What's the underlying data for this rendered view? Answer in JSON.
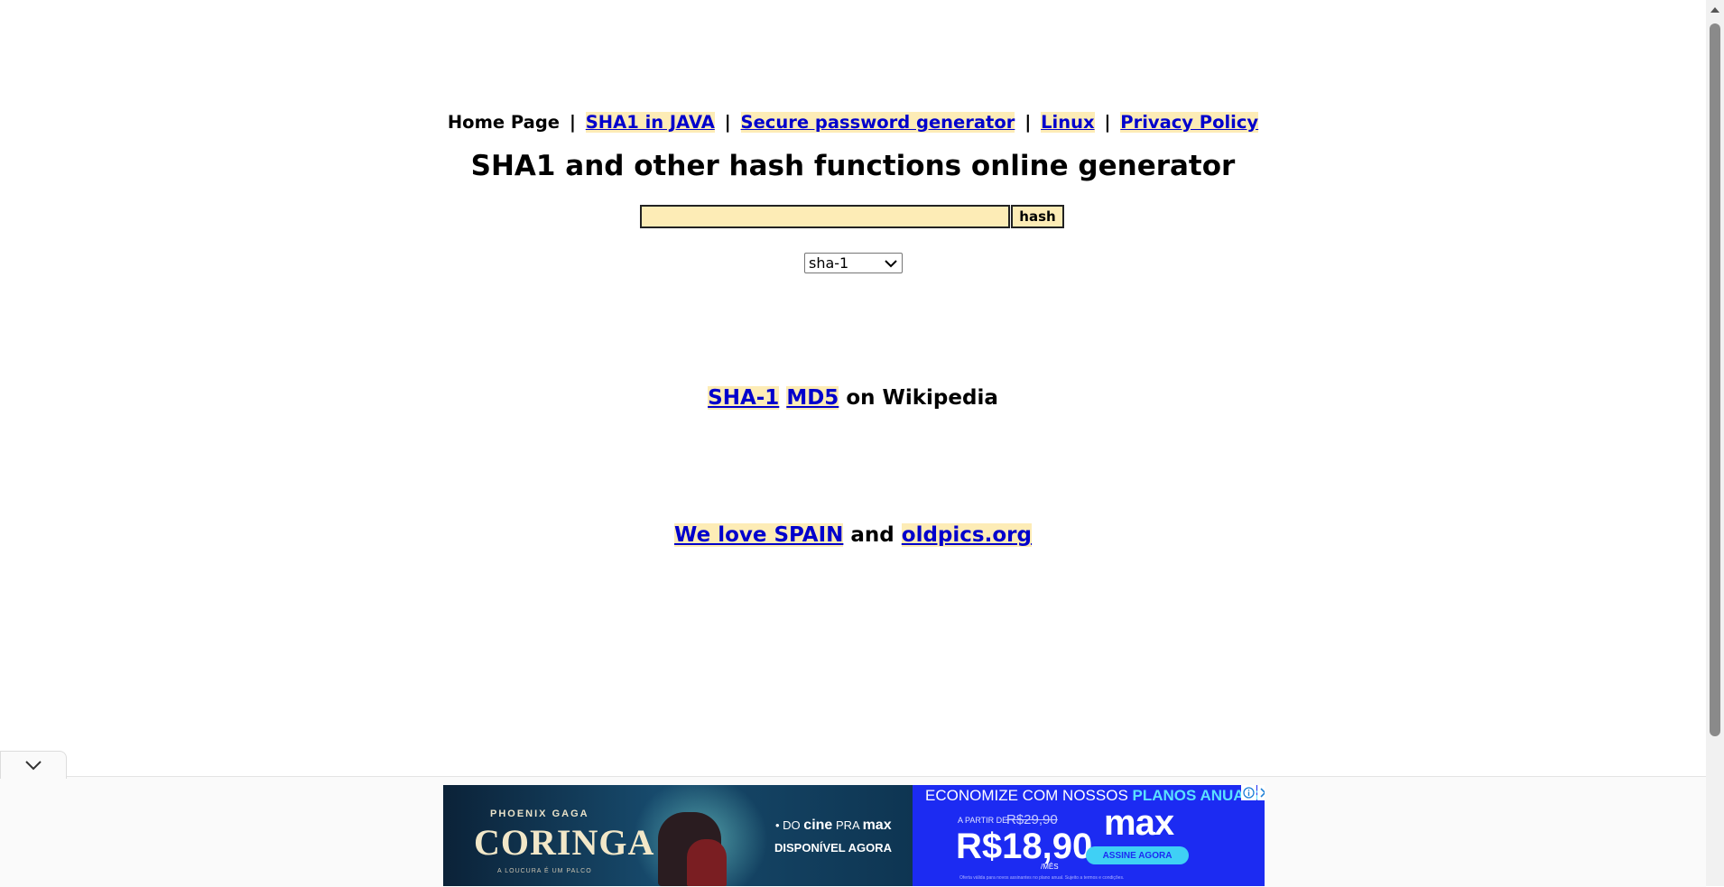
{
  "nav": {
    "home": "Home Page",
    "sep": "|",
    "links": [
      "SHA1 in JAVA",
      "Secure password generator",
      "Linux",
      "Privacy Policy"
    ]
  },
  "title": "SHA1 and other hash functions online generator",
  "form": {
    "input_value": "",
    "button_label": "hash",
    "algorithm_selected": "sha-1"
  },
  "wiki": {
    "link1": "SHA-1",
    "link2": "MD5",
    "suffix": "on Wikipedia"
  },
  "love": {
    "link1": "We love SPAIN",
    "middle": "and",
    "link2": "oldpics.org"
  },
  "ad": {
    "names": "PHOENIX   GAGA",
    "movie": "CORINGA",
    "tagline": "A LOUCURA É UM PALCO",
    "cine_pre": "• DO",
    "cine": "cine",
    "cine_mid": "PRA",
    "cine_max": "max",
    "available": "DISPONÍVEL AGORA",
    "economize": "ECONOMIZE COM NOSSOS",
    "plans": "PLANOS ANUAIS",
    "from": "A PARTIR DE",
    "old_price": "R$29,90",
    "price": "R$18,90",
    "per_month": "/MÊS",
    "brand": "max",
    "subscribe": "ASSINE AGORA",
    "fine_print": "Oferta válida para novos assinantes no plano anual. Sujeito a termos e condições."
  },
  "colors": {
    "link": "#0000cc",
    "highlight": "#fdecb6",
    "ad_blue": "#1c2bf2"
  }
}
